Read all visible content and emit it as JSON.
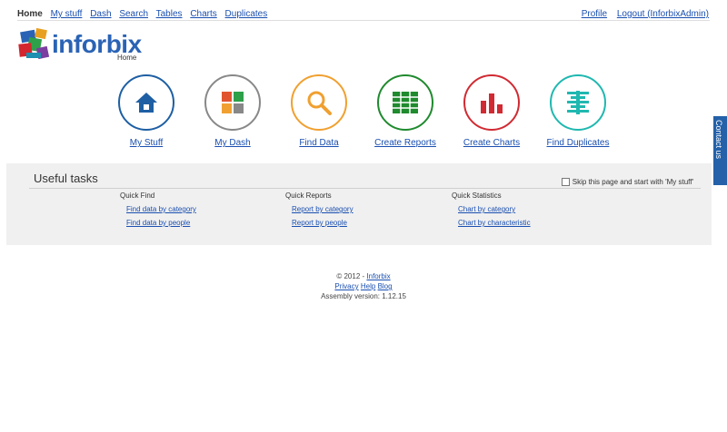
{
  "nav": {
    "items": [
      "Home",
      "My stuff",
      "Dash",
      "Search",
      "Tables",
      "Charts",
      "Duplicates"
    ],
    "profile": "Profile",
    "logout": "Logout (InforbixAdmin)"
  },
  "brand": {
    "name": "inforbix",
    "page": "Home"
  },
  "tiles": [
    {
      "label": "My Stuff",
      "icon": "house-icon",
      "color": "#1e5fa3"
    },
    {
      "label": "My Dash",
      "icon": "dashboard-icon",
      "color": "#888888"
    },
    {
      "label": "Find Data",
      "icon": "magnifier-icon",
      "color": "#f0a030"
    },
    {
      "label": "Create Reports",
      "icon": "table-icon",
      "color": "#1f8a2e"
    },
    {
      "label": "Create Charts",
      "icon": "bar-chart-icon",
      "color": "#d12a32"
    },
    {
      "label": "Find Duplicates",
      "icon": "duplicates-icon",
      "color": "#1fb8b0"
    }
  ],
  "useful": {
    "title": "Useful tasks",
    "skip_label": "Skip this page and start with 'My stuff'",
    "columns": [
      {
        "heading": "Quick Find",
        "links": [
          "Find data by category",
          "Find data by people"
        ]
      },
      {
        "heading": "Quick Reports",
        "links": [
          "Report by category",
          "Report by people"
        ]
      },
      {
        "heading": "Quick Statistics",
        "links": [
          "Chart by category",
          "Chart by characteristic"
        ]
      }
    ]
  },
  "footer": {
    "copyright": "© 2012 - ",
    "company": "Inforbix",
    "links": [
      "Privacy",
      "Help",
      "Blog"
    ],
    "assembly": "Assembly version: 1.12.15"
  },
  "contact": "Contact us"
}
